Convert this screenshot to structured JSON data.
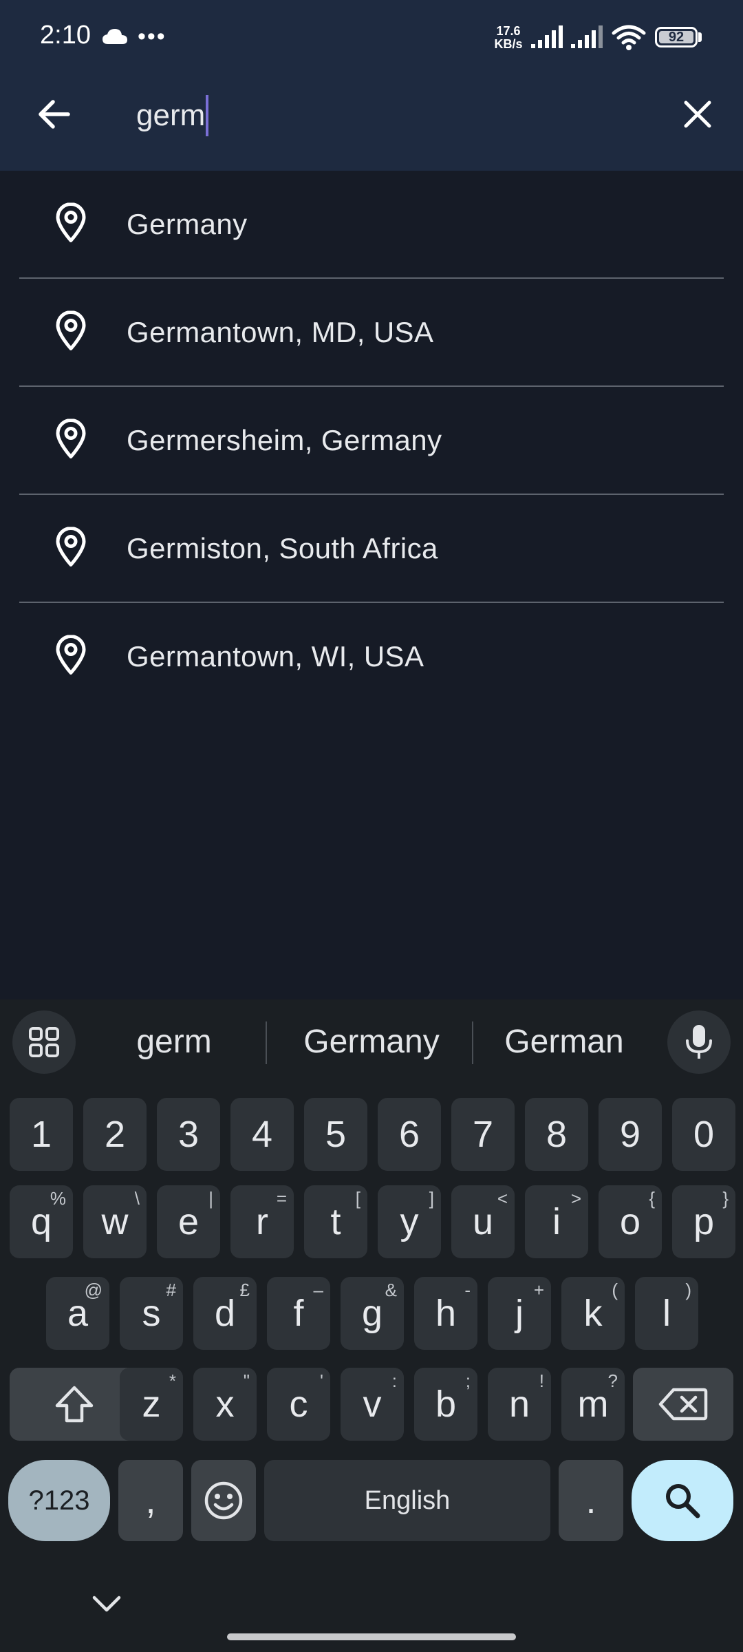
{
  "status_bar": {
    "time": "2:10",
    "net_speed_value": "17.6",
    "net_speed_unit": "KB/s",
    "battery": "92",
    "icons": [
      "cloud-icon",
      "more-dots-icon",
      "signal-icon",
      "signal-icon",
      "wifi-icon",
      "battery-icon"
    ]
  },
  "search": {
    "query": "germ",
    "back_icon": "arrow-left-icon",
    "clear_icon": "close-icon"
  },
  "results": [
    {
      "label": "Germany",
      "icon": "map-pin-icon"
    },
    {
      "label": "Germantown, MD, USA",
      "icon": "map-pin-icon"
    },
    {
      "label": "Germersheim, Germany",
      "icon": "map-pin-icon"
    },
    {
      "label": "Germiston, South Africa",
      "icon": "map-pin-icon"
    },
    {
      "label": "Germantown, WI, USA",
      "icon": "map-pin-icon"
    }
  ],
  "keyboard": {
    "suggestions": [
      "germ",
      "Germany",
      "German"
    ],
    "number_row": [
      "1",
      "2",
      "3",
      "4",
      "5",
      "6",
      "7",
      "8",
      "9",
      "0"
    ],
    "row1": [
      {
        "k": "q",
        "s": "%"
      },
      {
        "k": "w",
        "s": "\\"
      },
      {
        "k": "e",
        "s": "|"
      },
      {
        "k": "r",
        "s": "="
      },
      {
        "k": "t",
        "s": "["
      },
      {
        "k": "y",
        "s": "]"
      },
      {
        "k": "u",
        "s": "<"
      },
      {
        "k": "i",
        "s": ">"
      },
      {
        "k": "o",
        "s": "{"
      },
      {
        "k": "p",
        "s": "}"
      }
    ],
    "row2": [
      {
        "k": "a",
        "s": "@"
      },
      {
        "k": "s",
        "s": "#"
      },
      {
        "k": "d",
        "s": "£"
      },
      {
        "k": "f",
        "s": "–"
      },
      {
        "k": "g",
        "s": "&"
      },
      {
        "k": "h",
        "s": "-"
      },
      {
        "k": "j",
        "s": "+"
      },
      {
        "k": "k",
        "s": "("
      },
      {
        "k": "l",
        "s": ")"
      }
    ],
    "row3": [
      {
        "k": "z",
        "s": "*"
      },
      {
        "k": "x",
        "s": "\""
      },
      {
        "k": "c",
        "s": "'"
      },
      {
        "k": "v",
        "s": ":"
      },
      {
        "k": "b",
        "s": ";"
      },
      {
        "k": "n",
        "s": "!"
      },
      {
        "k": "m",
        "s": "?"
      }
    ],
    "symbols_label": "?123",
    "comma_label": ",",
    "space_label": "English",
    "period_label": ".",
    "colors": {
      "search_key": "#c2ecfc",
      "symbols_key": "#a3b5bf",
      "key": "#2e3338"
    }
  }
}
